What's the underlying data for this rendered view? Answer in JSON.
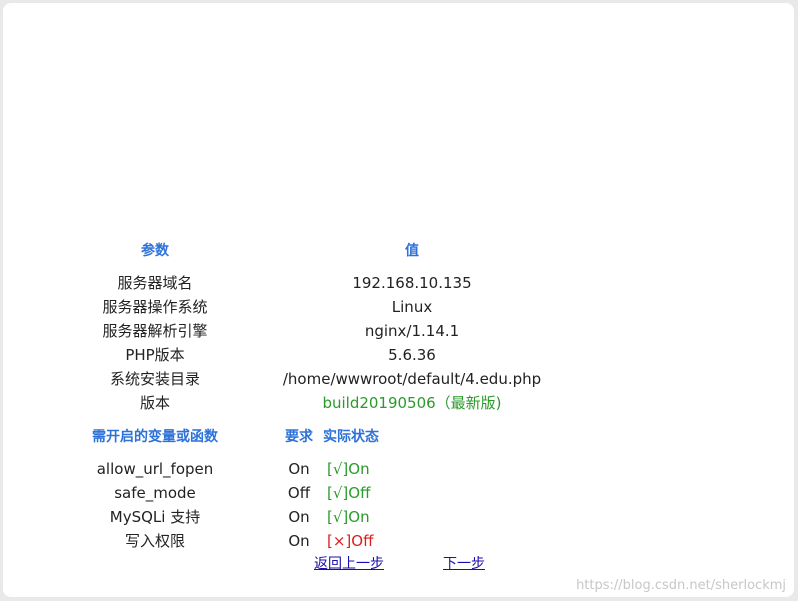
{
  "section1": {
    "header_param": "参数",
    "header_value": "值",
    "rows": [
      {
        "param": "服务器域名",
        "value": "192.168.10.135"
      },
      {
        "param": "服务器操作系统",
        "value": "Linux"
      },
      {
        "param": "服务器解析引擎",
        "value": "nginx/1.14.1"
      },
      {
        "param": "PHP版本",
        "value": "5.6.36"
      },
      {
        "param": "系统安装目录",
        "value": "/home/wwwroot/default/4.edu.php"
      },
      {
        "param": "版本",
        "value": "build20190506（最新版)"
      }
    ]
  },
  "section2": {
    "header_item": "需开启的变量或函数",
    "header_required": "要求",
    "header_status": "实际状态",
    "rows": [
      {
        "name": "allow_url_fopen",
        "required": "On",
        "status": "[√]On",
        "ok": true
      },
      {
        "name": "safe_mode",
        "required": "Off",
        "status": "[√]Off",
        "ok": true
      },
      {
        "name": "MySQLi 支持",
        "required": "On",
        "status": "[√]On",
        "ok": true
      },
      {
        "name": "写入权限",
        "required": "On",
        "status": "[×]Off",
        "ok": false
      }
    ]
  },
  "nav": {
    "back": "返回上一步",
    "next": "下一步"
  },
  "watermark": "https://blog.csdn.net/sherlockmj",
  "colors": {
    "header": "#2d72d9",
    "ok": "#2a9a2a",
    "bad": "#e01b1b",
    "link": "#1a0dab"
  }
}
